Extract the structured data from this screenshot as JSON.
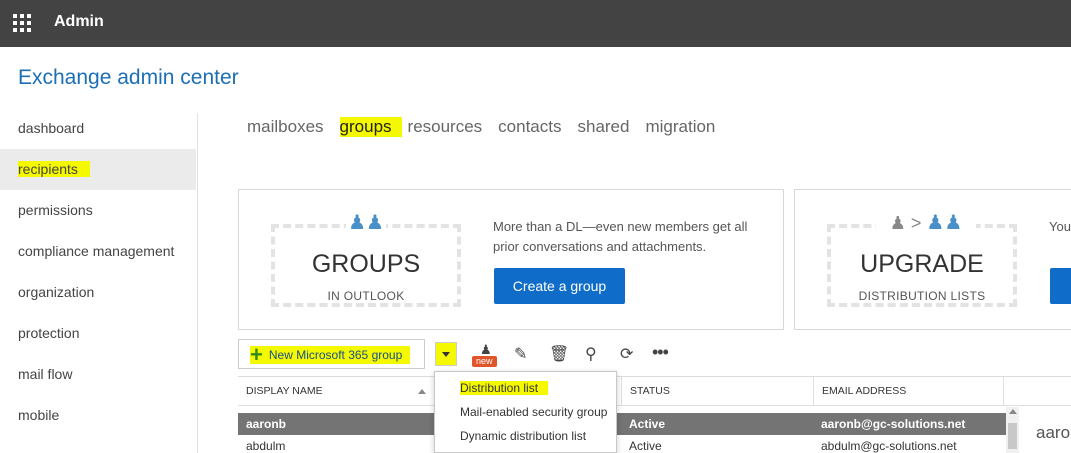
{
  "topbar": {
    "title": "Admin",
    "waffle_icon": "waffle-icon"
  },
  "app_title": "Exchange admin center",
  "sidebar": {
    "items": [
      {
        "label": "dashboard"
      },
      {
        "label": "recipients",
        "active": true
      },
      {
        "label": "permissions"
      },
      {
        "label": "compliance management"
      },
      {
        "label": "organization"
      },
      {
        "label": "protection"
      },
      {
        "label": "mail flow"
      },
      {
        "label": "mobile"
      }
    ]
  },
  "tabs": [
    {
      "label": "mailboxes"
    },
    {
      "label": "groups",
      "active": true
    },
    {
      "label": "resources"
    },
    {
      "label": "contacts"
    },
    {
      "label": "shared"
    },
    {
      "label": "migration"
    }
  ],
  "cards": {
    "groups": {
      "big": "GROUPS",
      "small": "IN OUTLOOK",
      "text": "More than a DL—even new members get all prior conversations and attachments.",
      "button": "Create a group"
    },
    "upgrade": {
      "big": "UPGRADE",
      "small": "DISTRIBUTION LISTS",
      "text": "You for u"
    }
  },
  "toolbar": {
    "new_label": "New Microsoft 365 group",
    "new_badge": "new",
    "icons": [
      "new-distribution-icon",
      "edit-icon",
      "delete-icon",
      "search-icon",
      "refresh-icon",
      "more-icon"
    ]
  },
  "dropdown_menu": {
    "items": [
      "Distribution list",
      "Mail-enabled security group",
      "Dynamic distribution list"
    ]
  },
  "grid": {
    "columns": [
      "DISPLAY NAME",
      "STATUS",
      "EMAIL ADDRESS"
    ],
    "rows": [
      {
        "name": "aaronb",
        "status": "Active",
        "email": "aaronb@gc-solutions.net",
        "selected": true
      },
      {
        "name": "abdulm",
        "status": "Active",
        "email": "abdulm@gc-solutions.net"
      }
    ]
  },
  "detail_pane": {
    "title": "aaro"
  },
  "colors": {
    "topbar": "#434343",
    "accent": "#1c6fb4",
    "button": "#0f6cc8",
    "highlight": "#f5f900"
  }
}
